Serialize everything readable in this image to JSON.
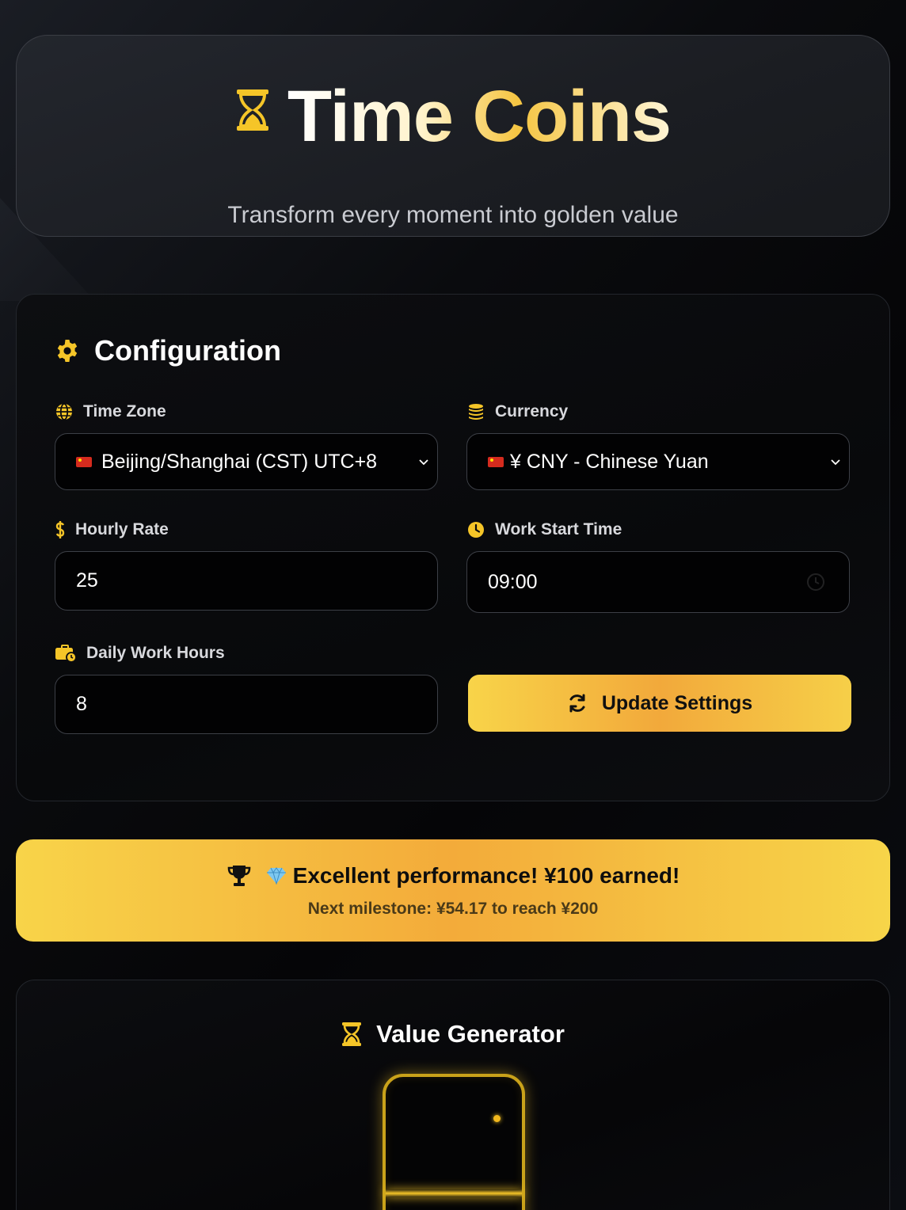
{
  "header": {
    "title": "Time Coins",
    "subtitle": "Transform every moment into golden value"
  },
  "config": {
    "section_title": "Configuration",
    "timezone": {
      "label": "Time Zone",
      "value": "Beijing/Shanghai (CST) UTC+8"
    },
    "currency": {
      "label": "Currency",
      "value": "¥ CNY - Chinese Yuan"
    },
    "hourly_rate": {
      "label": "Hourly Rate",
      "value": "25"
    },
    "work_start": {
      "label": "Work Start Time",
      "value": "09:00"
    },
    "daily_hours": {
      "label": "Daily Work Hours",
      "value": "8"
    },
    "update_button": "Update Settings"
  },
  "milestone": {
    "message": "Excellent performance! ¥100 earned!",
    "next": "Next milestone: ¥54.17 to reach ¥200"
  },
  "generator": {
    "title": "Value Generator"
  },
  "colors": {
    "accent": "#f5c528",
    "accent_orange": "#f2a93b",
    "background": "#07080b"
  },
  "icons": {
    "title": "hourglass-icon",
    "config": "gear-icon",
    "timezone": "globe-icon",
    "currency": "coins-icon",
    "hourly_rate": "dollar-icon",
    "work_start": "clock-icon",
    "daily_hours": "briefcase-clock-icon",
    "update": "refresh-icon",
    "milestone": "trophy-icon",
    "milestone_gem": "gem-icon",
    "generator": "hourglass-icon"
  }
}
